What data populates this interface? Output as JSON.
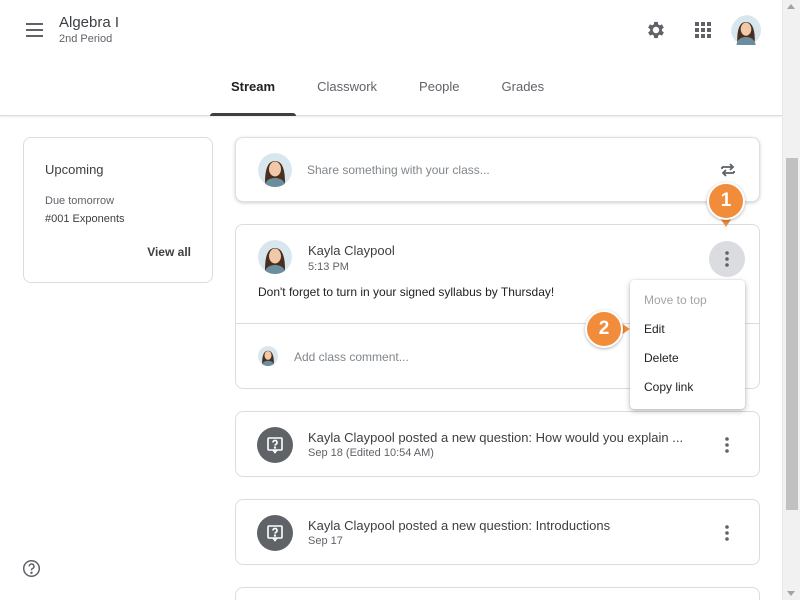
{
  "header": {
    "class_title": "Algebra I",
    "class_subtitle": "2nd Period",
    "tabs": [
      {
        "label": "Stream",
        "active": true
      },
      {
        "label": "Classwork",
        "active": false
      },
      {
        "label": "People",
        "active": false
      },
      {
        "label": "Grades",
        "active": false
      }
    ]
  },
  "upcoming": {
    "title": "Upcoming",
    "due": "Due tomorrow",
    "item": "#001 Exponents",
    "view_all": "View all"
  },
  "share": {
    "placeholder": "Share something with your class..."
  },
  "post": {
    "author": "Kayla Claypool",
    "time": "5:13 PM",
    "body": "Don't forget to turn in your signed syllabus by Thursday!",
    "comment_placeholder": "Add class comment..."
  },
  "menu": {
    "items": [
      {
        "label": "Move to top",
        "disabled": true
      },
      {
        "label": "Edit",
        "disabled": false
      },
      {
        "label": "Delete",
        "disabled": false
      },
      {
        "label": "Copy link",
        "disabled": false
      }
    ]
  },
  "questions": [
    {
      "title": "Kayla Claypool posted a new question: How would you explain ...",
      "date": "Sep 18 (Edited 10:54 AM)"
    },
    {
      "title": "Kayla Claypool posted a new question: Introductions",
      "date": "Sep 17"
    }
  ],
  "callouts": [
    "1",
    "2"
  ],
  "colors": {
    "callout": "#f08c3a",
    "text": "#3c4043",
    "muted": "#5f6368",
    "border": "#dadce0"
  },
  "icons": [
    "menu-icon",
    "gear-icon",
    "apps-icon",
    "repost-icon",
    "more-vert-icon",
    "question-icon",
    "help-icon"
  ]
}
